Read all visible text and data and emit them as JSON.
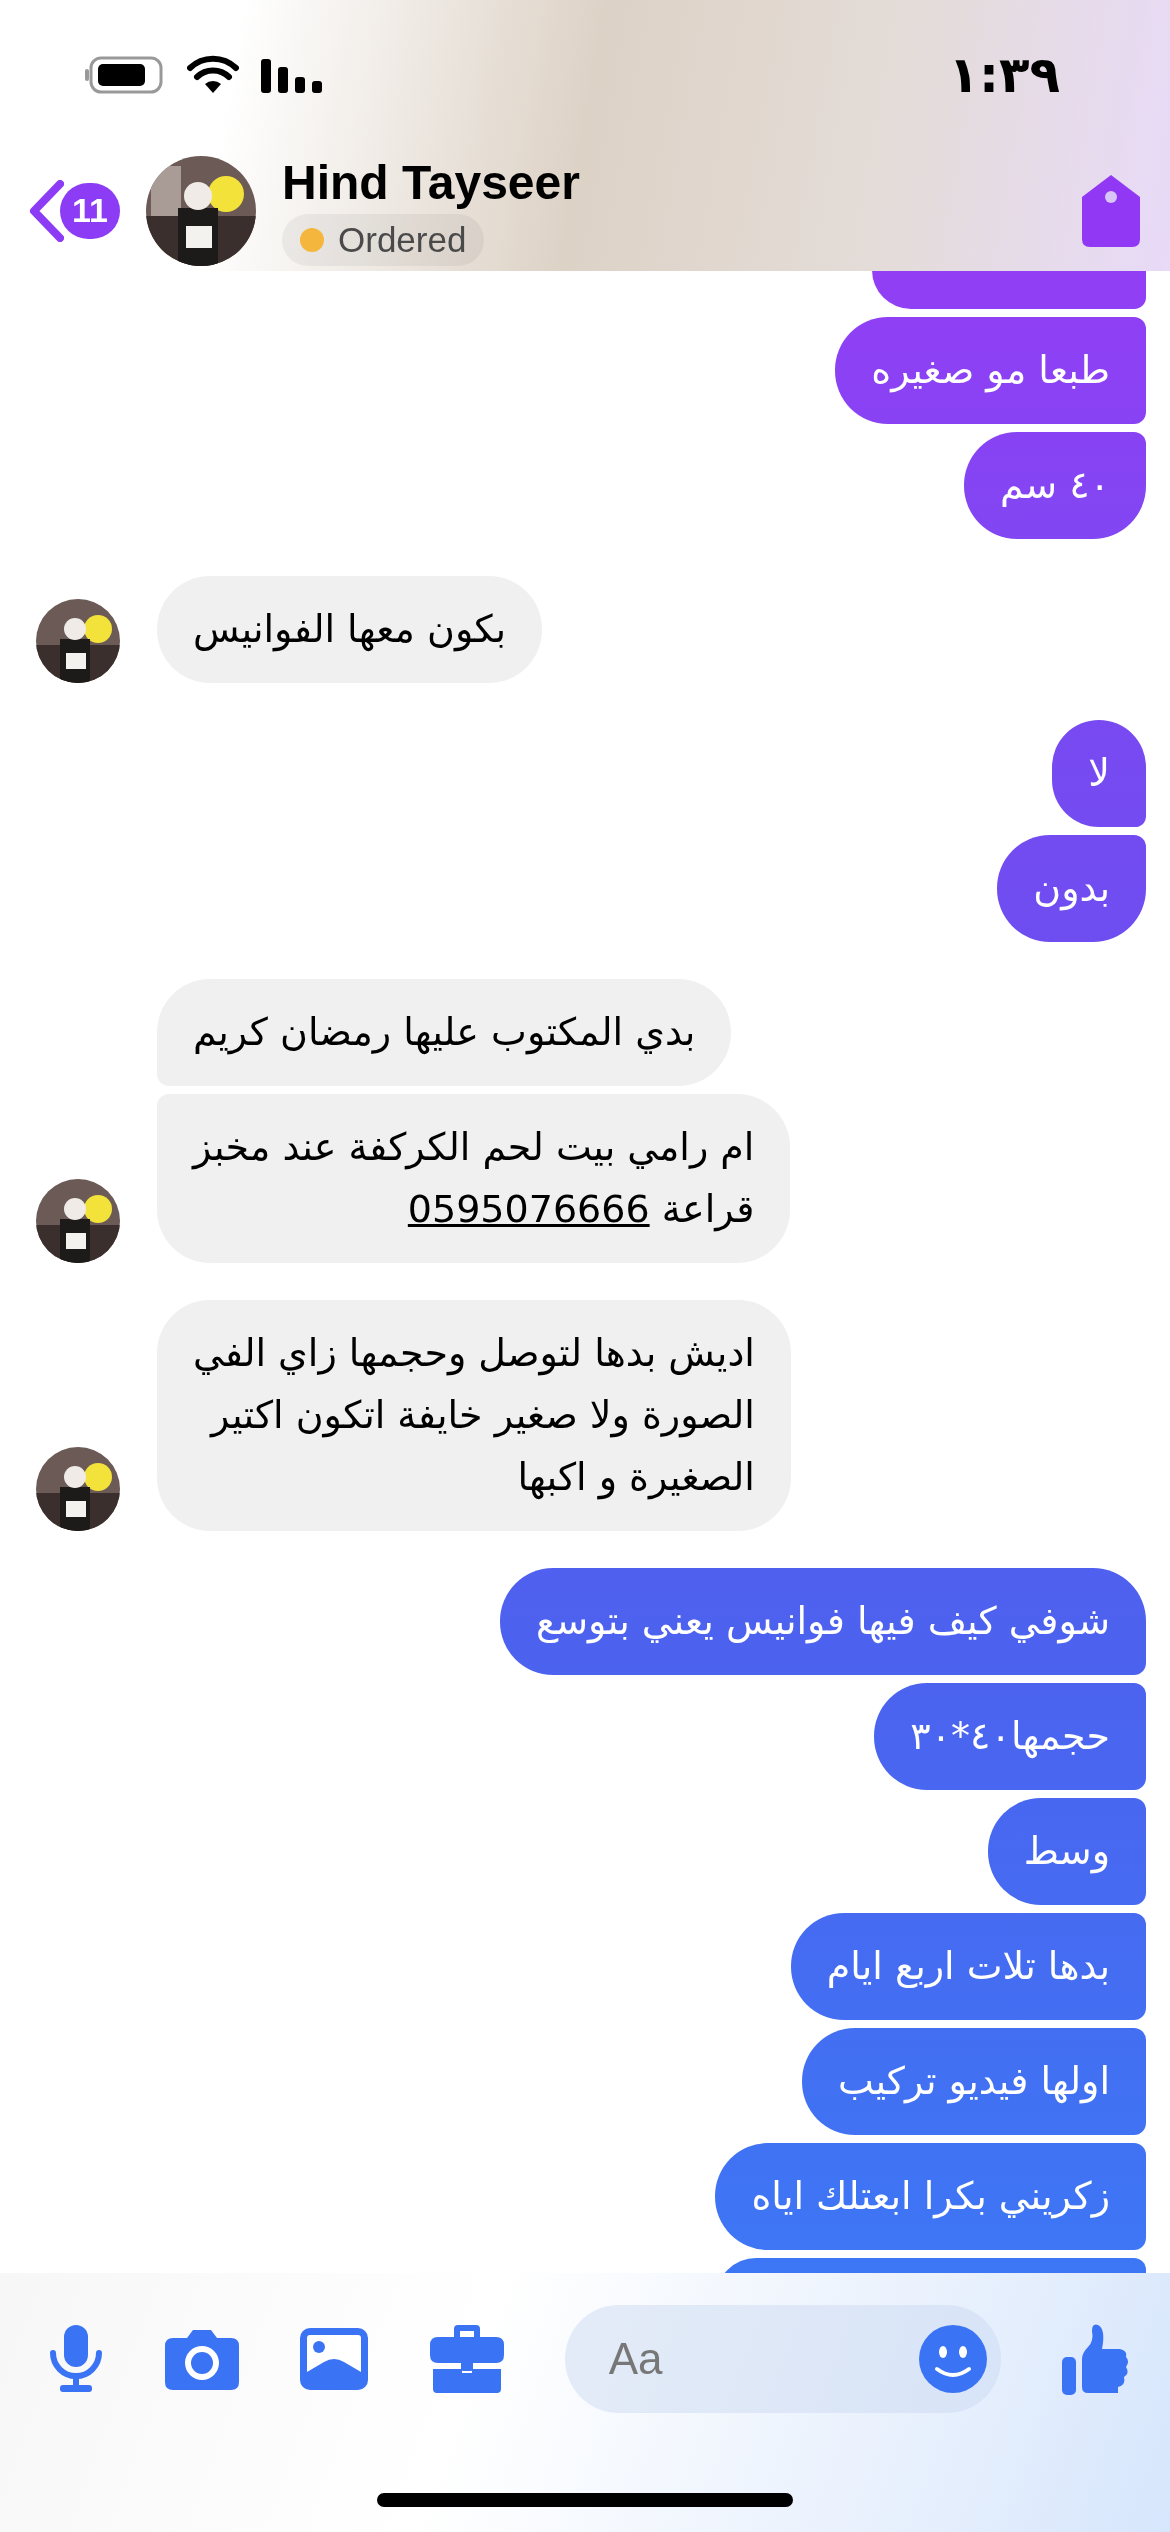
{
  "status_bar": {
    "time": "١:٣٩"
  },
  "header": {
    "back_badge": "11",
    "name": "Hind Tayseer",
    "status": {
      "label": "Ordered",
      "color": "#f4b63c"
    }
  },
  "groups": [
    {
      "kind": "sent",
      "messages": [
        {
          "kind": "partial"
        },
        {
          "kind": "text",
          "text": "طبعا مو صغيره"
        },
        {
          "kind": "text",
          "text": "٤٠ سم"
        }
      ]
    },
    {
      "kind": "received",
      "messages": [
        {
          "kind": "text",
          "text": "بكون معها الفوانيس"
        }
      ]
    },
    {
      "kind": "sent",
      "messages": [
        {
          "kind": "text",
          "text": "لا"
        },
        {
          "kind": "text",
          "text": "بدون"
        }
      ]
    },
    {
      "kind": "received",
      "messages": [
        {
          "kind": "text",
          "text": "بدي المكتوب عليها رمضان كريم"
        },
        {
          "kind": "text",
          "text": "ام رامي بيت لحم الكركفة عند مخبز\nقراعة",
          "link": "0595076666"
        }
      ]
    },
    {
      "kind": "received",
      "messages": [
        {
          "kind": "text",
          "text": "اديش بدها لتوصل  وحجمها زاي الفي\nالصورة ولا صغير خايفة اتكون اكتير\nالصغيرة و اكبها"
        }
      ]
    },
    {
      "kind": "sent",
      "messages": [
        {
          "kind": "text",
          "text": "شوفي كيف فيها فوانيس يعني بتوسع"
        },
        {
          "kind": "text",
          "text": "حجمها٤٠*٣٠"
        },
        {
          "kind": "text",
          "text": "وسط"
        },
        {
          "kind": "text",
          "text": "بدها تلات اربع ايام"
        },
        {
          "kind": "text",
          "text": "اولها فيديو تركيب"
        },
        {
          "kind": "text",
          "text": "زكريني بكرا ابعتلك اياه"
        },
        {
          "kind": "partial"
        }
      ]
    }
  ],
  "composer": {
    "placeholder": "Aa"
  }
}
